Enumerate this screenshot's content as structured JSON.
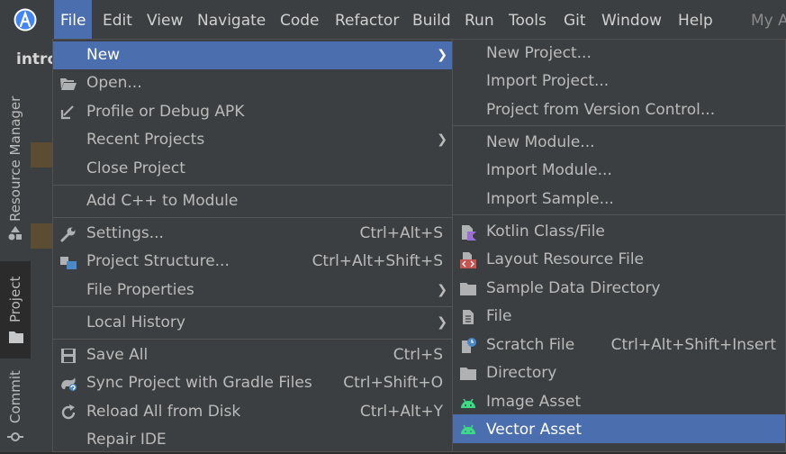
{
  "menubar": {
    "items": [
      "File",
      "Edit",
      "View",
      "Navigate",
      "Code",
      "Refactor",
      "Build",
      "Run",
      "Tools",
      "Git",
      "Window",
      "Help"
    ],
    "window_title": "My A"
  },
  "project": {
    "name": "intro"
  },
  "side_tabs": [
    "Resource Manager",
    "Project",
    "Commit"
  ],
  "file_menu": {
    "new": "New",
    "open": "Open...",
    "profile_debug": "Profile or Debug APK",
    "recent_projects": "Recent Projects",
    "close_project": "Close Project",
    "add_cpp": "Add C++ to Module",
    "settings": "Settings...",
    "settings_shortcut": "Ctrl+Alt+S",
    "project_structure": "Project Structure...",
    "project_structure_shortcut": "Ctrl+Alt+Shift+S",
    "file_properties": "File Properties",
    "local_history": "Local History",
    "save_all": "Save All",
    "save_all_shortcut": "Ctrl+S",
    "sync_gradle": "Sync Project with Gradle Files",
    "sync_gradle_shortcut": "Ctrl+Shift+O",
    "reload_disk": "Reload All from Disk",
    "reload_disk_shortcut": "Ctrl+Alt+Y",
    "repair_ide": "Repair IDE"
  },
  "new_submenu": {
    "new_project": "New Project...",
    "import_project": "Import Project...",
    "project_vcs": "Project from Version Control...",
    "new_module": "New Module...",
    "import_module": "Import Module...",
    "import_sample": "Import Sample...",
    "kotlin_class": "Kotlin Class/File",
    "layout_resource": "Layout Resource File",
    "sample_data_dir": "Sample Data Directory",
    "file": "File",
    "scratch_file": "Scratch File",
    "scratch_file_shortcut": "Ctrl+Alt+Shift+Insert",
    "directory": "Directory",
    "image_asset": "Image Asset",
    "vector_asset": "Vector Asset"
  },
  "colors": {
    "selection": "#4b6eaf",
    "menu_bg": "#3c3f41",
    "android_green": "#3ddc84"
  }
}
